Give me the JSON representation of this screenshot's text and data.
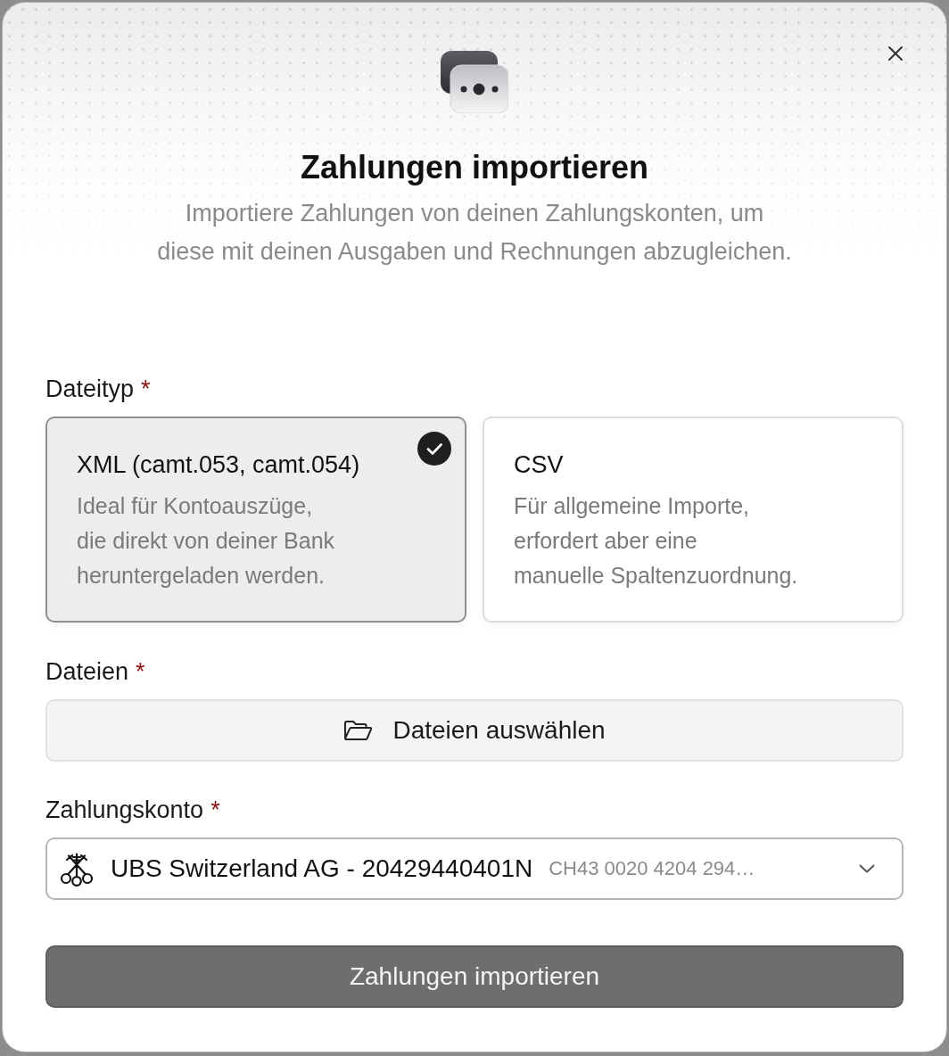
{
  "header": {
    "title": "Zahlungen importieren",
    "subtitle": "Importiere Zahlungen von deinen Zahlungskonten, um diese mit deinen Ausgaben und Rechnungen abzugleichen."
  },
  "file_type": {
    "label": "Dateityp",
    "required_mark": "*",
    "options": [
      {
        "title": "XML (camt.053, camt.054)",
        "description": "Ideal für Kontoauszüge,\ndie direkt von deiner Bank\nheruntergeladen werden.",
        "selected": true
      },
      {
        "title": "CSV",
        "description": "Für allgemeine Importe,\nerfordert aber eine\nmanuelle Spaltenzuordnung.",
        "selected": false
      }
    ]
  },
  "files": {
    "label": "Dateien",
    "required_mark": "*",
    "button": "Dateien auswählen"
  },
  "payment_account": {
    "label": "Zahlungskonto",
    "required_mark": "*",
    "value": "UBS Switzerland AG - 20429440401N",
    "detail": "CH43 0020 4204 294…"
  },
  "submit": {
    "label": "Zahlungen importieren",
    "disabled": true
  }
}
